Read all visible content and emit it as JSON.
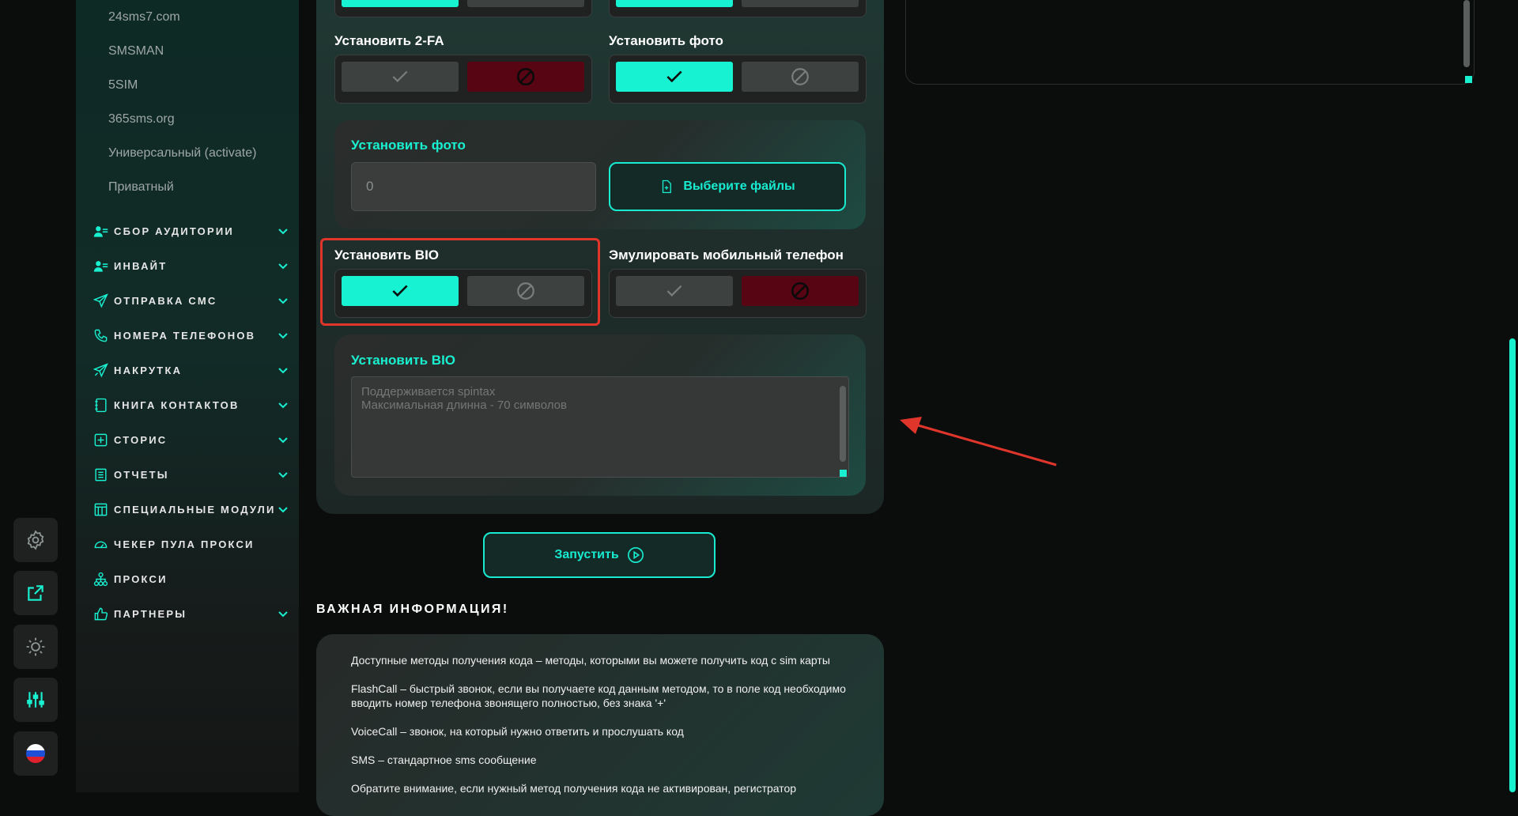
{
  "sidebar": {
    "sub_items": [
      "24sms7.com",
      "SMSMAN",
      "5SIM",
      "365sms.org",
      "Универсальный (activate)",
      "Приватный"
    ],
    "nav": [
      {
        "label": "СБОР АУДИТОРИИ",
        "icon": "users-icon",
        "chevron": true
      },
      {
        "label": "ИНВАЙТ",
        "icon": "user-plus-icon",
        "chevron": true
      },
      {
        "label": "ОТПРАВКА СМС",
        "icon": "send-icon",
        "chevron": true
      },
      {
        "label": "НОМЕРА ТЕЛЕФОНОВ",
        "icon": "phone-icon",
        "chevron": true
      },
      {
        "label": "НАКРУТКА",
        "icon": "boost-icon",
        "chevron": true
      },
      {
        "label": "КНИГА КОНТАКТОВ",
        "icon": "contacts-book-icon",
        "chevron": true
      },
      {
        "label": "СТОРИС",
        "icon": "plus-square-icon",
        "chevron": true
      },
      {
        "label": "ОТЧЕТЫ",
        "icon": "report-icon",
        "chevron": true
      },
      {
        "label": "СПЕЦИАЛЬНЫЕ МОДУЛИ",
        "icon": "modules-icon",
        "chevron": true
      },
      {
        "label": "ЧЕКЕР ПУЛА ПРОКСИ",
        "icon": "speedometer-icon",
        "chevron": false
      },
      {
        "label": "ПРОКСИ",
        "icon": "network-icon",
        "chevron": false
      },
      {
        "label": "ПАРТНЕРЫ",
        "icon": "thumbs-up-icon",
        "chevron": true
      }
    ]
  },
  "rail": [
    "settings-icon",
    "external-link-icon",
    "theme-icon",
    "sliders-icon",
    "russia-flag-icon"
  ],
  "form": {
    "twofa": {
      "label": "Установить 2-FA",
      "state": "off"
    },
    "photo_toggle": {
      "label": "Установить фото",
      "state": "on"
    },
    "photo_panel": {
      "title": "Установить фото",
      "count_value": "0",
      "file_button": "Выберите файлы"
    },
    "bio_toggle": {
      "label": "Установить BIO",
      "state": "on"
    },
    "emulate": {
      "label": "Эмулировать мобильный телефон",
      "state": "off"
    },
    "bio_panel": {
      "title": "Установить BIO",
      "placeholder": "Поддерживается spintax\nМаксимальная длинна - 70 символов"
    },
    "run_button": "Запустить"
  },
  "info": {
    "heading": "ВАЖНАЯ ИНФОРМАЦИЯ!",
    "lines": [
      "Доступные методы получения кода – методы, которыми вы можете получить код с sim карты",
      "FlashCall – быстрый звонок, если вы получаете код данным методом, то в поле код необходимо вводить номер телефона звонящего полностью, без знака '+'",
      "VoiceCall – звонок, на который нужно ответить и прослушать код",
      "SMS – стандартное sms сообщение",
      "Обратите внимание, если нужный метод получения кода не активирован, регистратор"
    ]
  },
  "colors": {
    "accent": "#18f0d0",
    "danger": "#570413",
    "highlight": "#e0352b"
  }
}
